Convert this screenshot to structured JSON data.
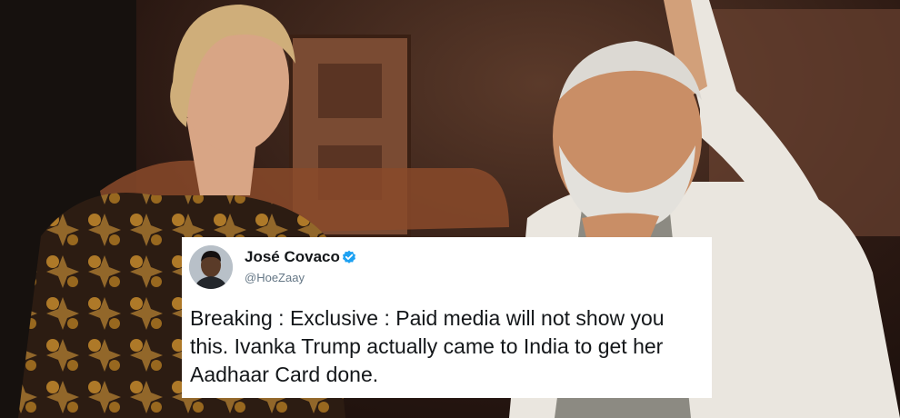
{
  "photo": {
    "description_icon": "photo-background",
    "colors": {
      "wall": "#5b3a2a",
      "dress": "#2c1c12",
      "gold": "#c48a2c",
      "kurta": "#eae6df",
      "vest": "#8c8a82",
      "skin": "#d8a585"
    }
  },
  "tweet": {
    "author_name": "José Covaco",
    "handle": "@HoeZaay",
    "verified_icon": "verified-badge-icon",
    "text": "Breaking : Exclusive : Paid media will not show you this. Ivanka Trump actually came to India to get her Aadhaar Card done.",
    "colors": {
      "card": "#ffffff",
      "text": "#14171a",
      "handle": "#657786",
      "badge": "#1da1f2"
    }
  }
}
